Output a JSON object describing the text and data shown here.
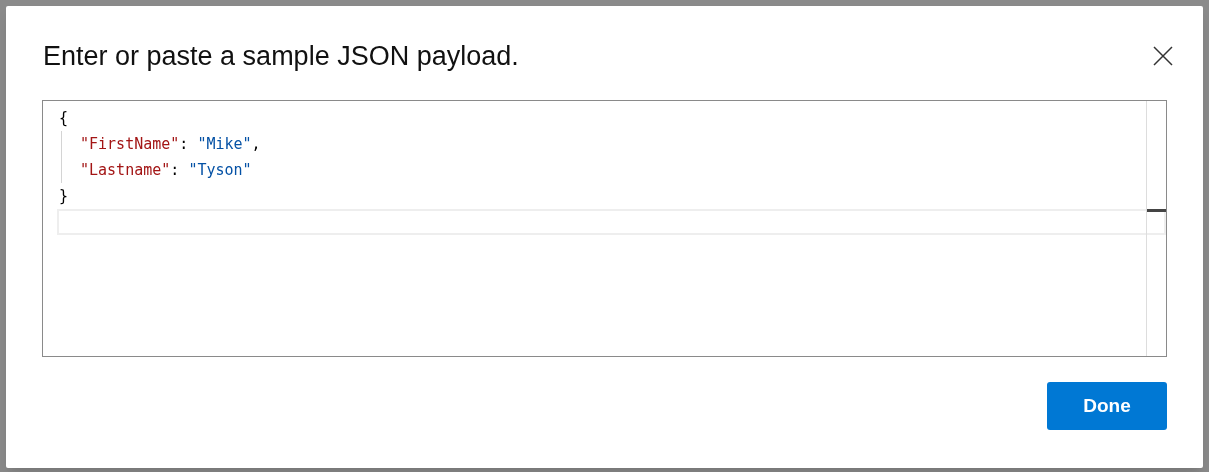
{
  "dialog": {
    "title": "Enter or paste a sample JSON payload.",
    "editor": {
      "lines": [
        {
          "indented": false,
          "current": false,
          "tokens": [
            {
              "kind": "punct",
              "text": "{"
            }
          ]
        },
        {
          "indented": true,
          "current": false,
          "tokens": [
            {
              "kind": "key",
              "text": "\"FirstName\""
            },
            {
              "kind": "punct",
              "text": ": "
            },
            {
              "kind": "string",
              "text": "\"Mike\""
            },
            {
              "kind": "punct",
              "text": ","
            }
          ]
        },
        {
          "indented": true,
          "current": false,
          "tokens": [
            {
              "kind": "key",
              "text": "\"Lastname\""
            },
            {
              "kind": "punct",
              "text": ": "
            },
            {
              "kind": "string",
              "text": "\"Tyson\""
            }
          ]
        },
        {
          "indented": false,
          "current": false,
          "tokens": [
            {
              "kind": "punct",
              "text": "}"
            }
          ]
        },
        {
          "current": true
        }
      ]
    },
    "buttons": [
      {
        "label": "Done",
        "primary": true
      }
    ]
  }
}
